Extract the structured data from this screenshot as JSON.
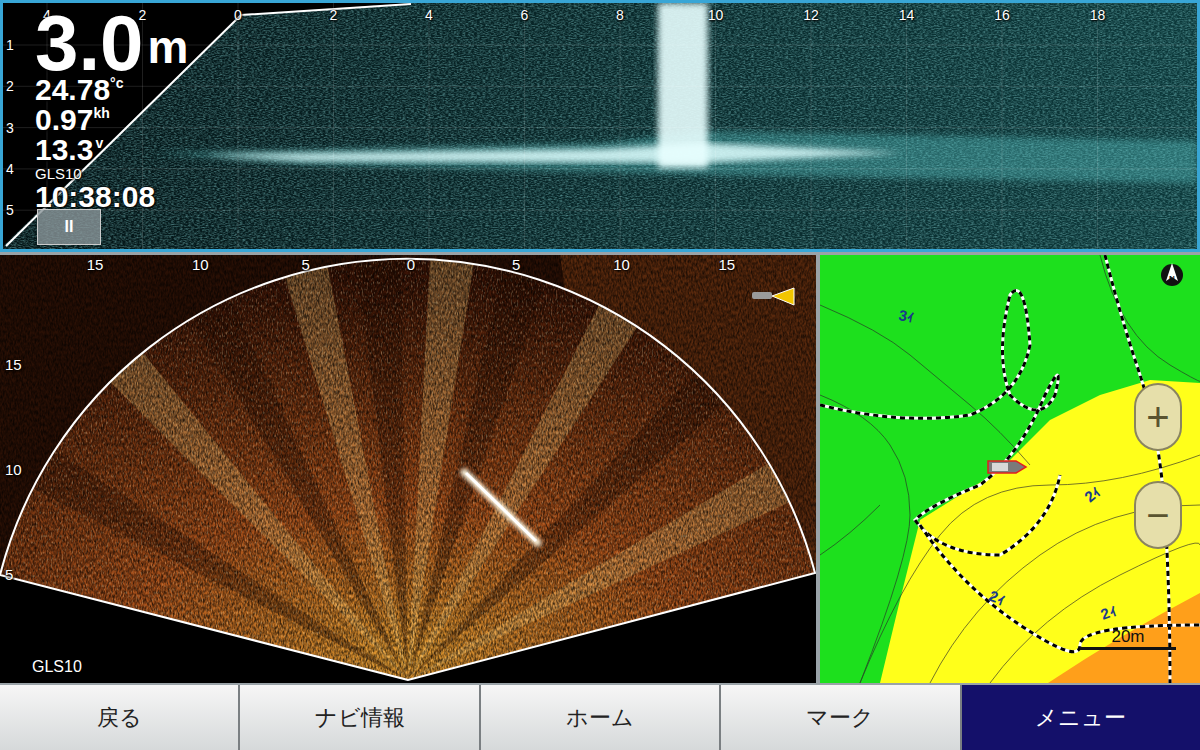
{
  "sonar_down": {
    "depth": "3.0",
    "depth_unit": "m",
    "water_temp": "24.78",
    "temp_unit": "°c",
    "speed": "0.97",
    "speed_unit": "kh",
    "voltage": "13.3",
    "voltage_unit": "v",
    "source": "GLS10",
    "time": "10:38:08",
    "pause_button": "II",
    "axis_top": [
      "4",
      "2",
      "0",
      "2",
      "4",
      "6",
      "8",
      "10",
      "12",
      "14",
      "16",
      "18"
    ],
    "axis_left": [
      "1",
      "2",
      "3",
      "4",
      "5"
    ]
  },
  "sonar_forward": {
    "source": "GLS10",
    "axis_top": [
      "15",
      "10",
      "5",
      "0",
      "5",
      "10",
      "15"
    ],
    "axis_left": [
      "15",
      "10",
      "5"
    ]
  },
  "map": {
    "north": "N",
    "zoom_in": "+",
    "zoom_out": "−",
    "scale": "20m",
    "contour_labels": [
      "3ｨ",
      "2ｨ",
      "2ｨ",
      "2ｨ"
    ]
  },
  "bottom_bar": [
    {
      "label": "戻る",
      "selected": false
    },
    {
      "label": "ナビ情報",
      "selected": false
    },
    {
      "label": "ホーム",
      "selected": false
    },
    {
      "label": "マーク",
      "selected": false
    },
    {
      "label": "メニュー",
      "selected": true
    }
  ]
}
